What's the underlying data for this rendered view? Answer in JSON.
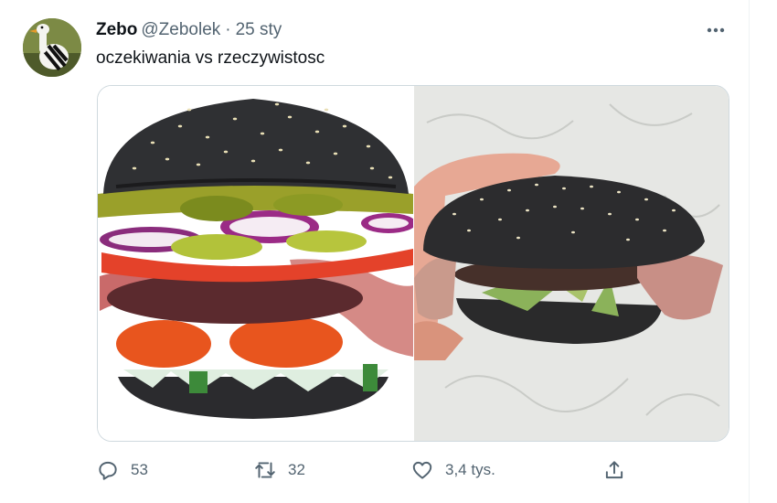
{
  "tweet": {
    "author_name": "Zebo",
    "author_handle": "@Zebolek",
    "separator": "·",
    "time": "25 sty",
    "text": "oczekiwania vs rzeczywistosc",
    "more_icon": "more-horizontal-icon",
    "avatar_icon": "goose-avatar",
    "media": {
      "left_image": "black-bun-burger-advertisement-photo",
      "right_image": "black-bun-burger-real-photo"
    }
  },
  "actions": {
    "reply": {
      "icon": "reply-icon",
      "count": "53"
    },
    "retweet": {
      "icon": "retweet-icon",
      "count": "32"
    },
    "like": {
      "icon": "heart-icon",
      "count": "3,4 tys."
    },
    "share": {
      "icon": "share-icon"
    }
  },
  "colors": {
    "text": "#0f1419",
    "secondary": "#536471",
    "border": "#cfd9de"
  }
}
